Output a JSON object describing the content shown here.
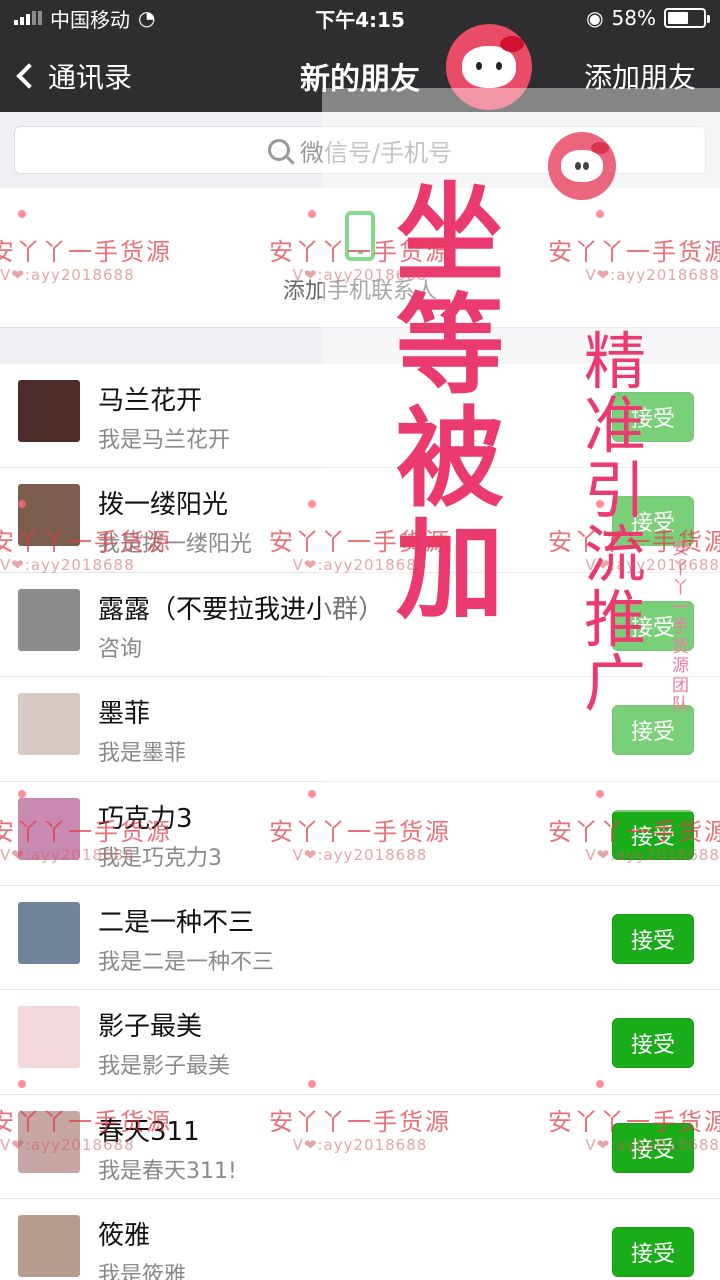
{
  "status_bar": {
    "carrier": "中国移动",
    "time": "下午4:15",
    "battery_text": "58%",
    "battery_level": 0.58,
    "icons": [
      "signal-icon",
      "wifi-icon",
      "rotation-lock-icon",
      "battery-icon"
    ]
  },
  "nav": {
    "back_label": "通讯录",
    "title": "新的朋友",
    "action_label": "添加朋友"
  },
  "search": {
    "placeholder": "微信号/手机号"
  },
  "phone_section": {
    "label": "添加手机联系人"
  },
  "requests": [
    {
      "name": "马兰花开",
      "message": "我是马兰花开",
      "button": "接受",
      "avatar_color": "#4c2b28"
    },
    {
      "name": "拨一缕阳光",
      "message": "我是拨一缕阳光",
      "button": "接受",
      "avatar_color": "#7b5d4d"
    },
    {
      "name": "露露（不要拉我进小群）",
      "message": "咨询",
      "button": "接受",
      "avatar_color": "#8c8c8c"
    },
    {
      "name": "墨菲",
      "message": "我是墨菲",
      "button": "接受",
      "avatar_color": "#d8c9c4"
    },
    {
      "name": "巧克力3",
      "message": "我是巧克力3",
      "button": "接受",
      "avatar_color": "#c98ab2"
    },
    {
      "name": "二是一种不三",
      "message": "我是二是一种不三",
      "button": "接受",
      "avatar_color": "#70859a"
    },
    {
      "name": "影子最美",
      "message": "我是影子最美",
      "button": "接受",
      "avatar_color": "#f2d8db"
    },
    {
      "name": "春天311",
      "message": "我是春天311!",
      "button": "接受",
      "avatar_color": "#c7a7a4"
    },
    {
      "name": "筱雅",
      "message": "我是筱雅",
      "button": "接受",
      "avatar_color": "#b69b8f"
    }
  ],
  "overlay": {
    "handwritten_main": "坐等被加",
    "handwritten_side": "精准引流推广",
    "vertical_side": "安丫丫一手货源团队"
  },
  "watermark": {
    "line_text": "安丫丫一手货源",
    "sub_text": "V❤:ayy2018688"
  }
}
